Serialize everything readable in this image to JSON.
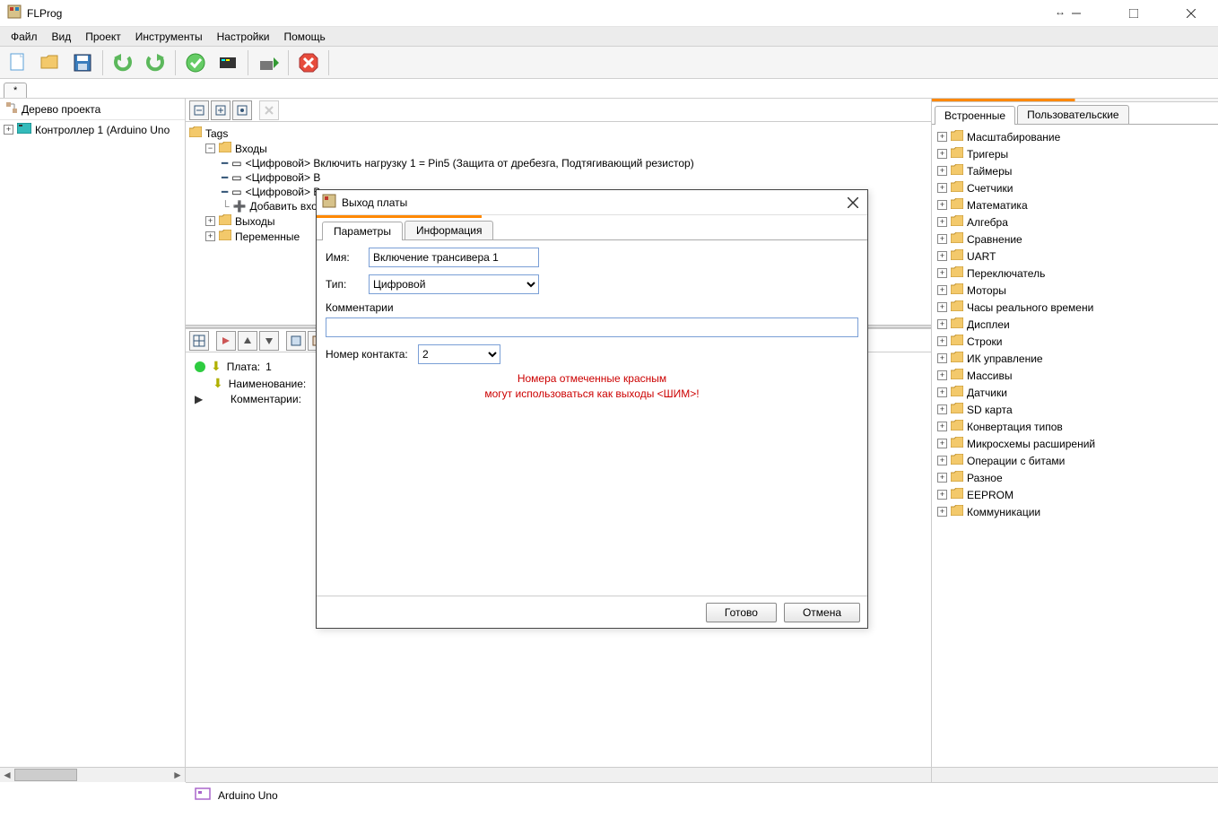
{
  "app": {
    "title": "FLProg"
  },
  "menu": [
    "Файл",
    "Вид",
    "Проект",
    "Инструменты",
    "Настройки",
    "Помощь"
  ],
  "doctab": "*",
  "left": {
    "header": "Дерево проекта",
    "controller": "Контроллер 1 (Arduino Uno"
  },
  "midtree": {
    "root": "Tags",
    "inputs": "Входы",
    "inputrows": [
      "<Цифровой>  Включить нагрузку 1 = Pin5 (Защита от дребезга, Подтягивающий резистор)",
      "<Цифровой>  В",
      "<Цифровой>  В"
    ],
    "addinput": "Добавить вход",
    "outputs": "Выходы",
    "vars": "Переменные"
  },
  "details": {
    "row1_label": "Плата:",
    "row1_val": "1",
    "row2_label": "Наименование:",
    "row3_label": "Комментарии:"
  },
  "right": {
    "tab1": "Встроенные",
    "tab2": "Пользовательские",
    "items": [
      "Масштабирование",
      "Тригеры",
      "Таймеры",
      "Счетчики",
      "Математика",
      "Алгебра",
      "Сравнение",
      "UART",
      "Переключатель",
      "Моторы",
      "Часы реального времени",
      "Дисплеи",
      "Строки",
      "ИК управление",
      "Массивы",
      "Датчики",
      "SD карта",
      "Конвертация типов",
      "Микросхемы расширений",
      "Операции с битами",
      "Разное",
      "EEPROM",
      "Коммуникации"
    ]
  },
  "status": {
    "board": "Arduino Uno"
  },
  "dialog": {
    "title": "Выход платы",
    "tab1": "Параметры",
    "tab2": "Информация",
    "name_label": "Имя:",
    "name_value": "Включение трансивера 1",
    "type_label": "Тип:",
    "type_value": "Цифровой",
    "comments_label": "Комментарии",
    "contact_label": "Номер контакта:",
    "contact_value": "2",
    "warn1": "Номера отмеченные красным",
    "warn2": "могут использоваться как выходы <ШИМ>!",
    "ok": "Готово",
    "cancel": "Отмена"
  }
}
